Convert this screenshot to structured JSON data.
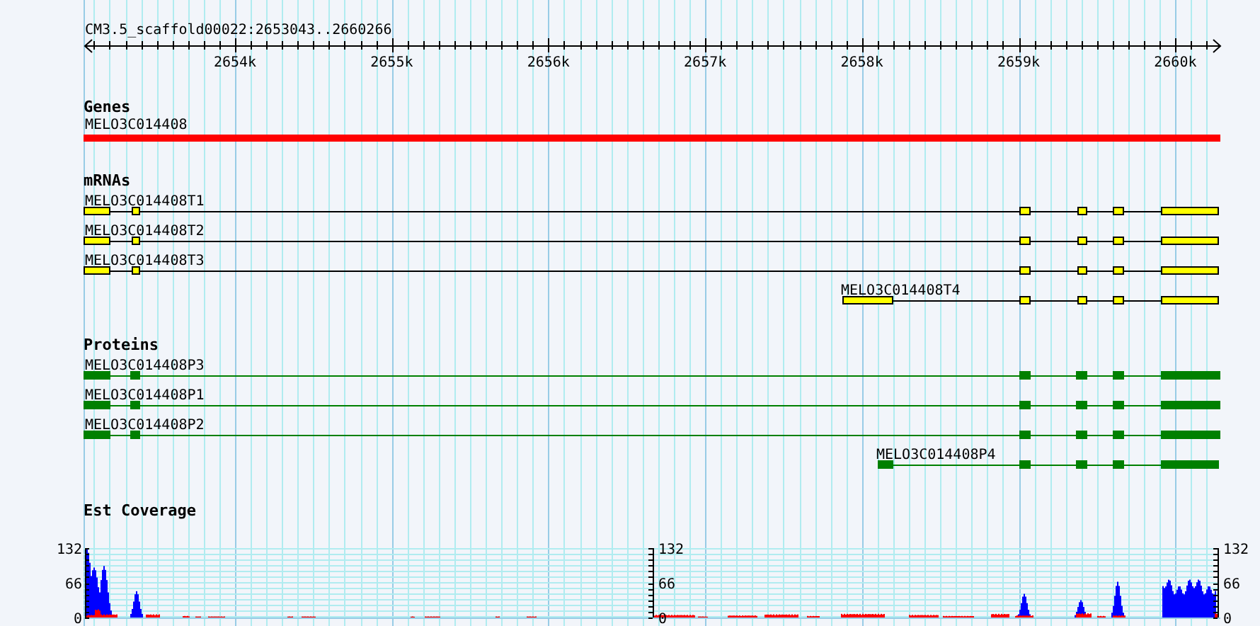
{
  "location": "CM3.5_scaffold00022:2653043..2660266",
  "ruler_ticks": [
    "2654k",
    "2655k",
    "2656k",
    "2657k",
    "2658k",
    "2659k",
    "2660k"
  ],
  "tracks": [
    {
      "kind": "genes",
      "title": "Genes",
      "features": [
        {
          "name": "MELO3C014408"
        }
      ]
    },
    {
      "kind": "mrnas",
      "title": "mRNAs",
      "features": [
        {
          "name": "MELO3C014408T1"
        },
        {
          "name": "MELO3C014408T2"
        },
        {
          "name": "MELO3C014408T3"
        },
        {
          "name": "MELO3C014408T4"
        }
      ]
    },
    {
      "kind": "proteins",
      "title": "Proteins",
      "features": [
        {
          "name": "MELO3C014408P3"
        },
        {
          "name": "MELO3C014408P1"
        },
        {
          "name": "MELO3C014408P2"
        },
        {
          "name": "MELO3C014408P4"
        }
      ]
    },
    {
      "kind": "coverage",
      "title": "Est Coverage",
      "axes": [
        {
          "labels": [
            "132",
            "66",
            "0"
          ]
        },
        {
          "labels": [
            "132",
            "66",
            "0"
          ]
        },
        {
          "labels": [
            "132",
            "66",
            "0"
          ]
        }
      ]
    }
  ]
}
